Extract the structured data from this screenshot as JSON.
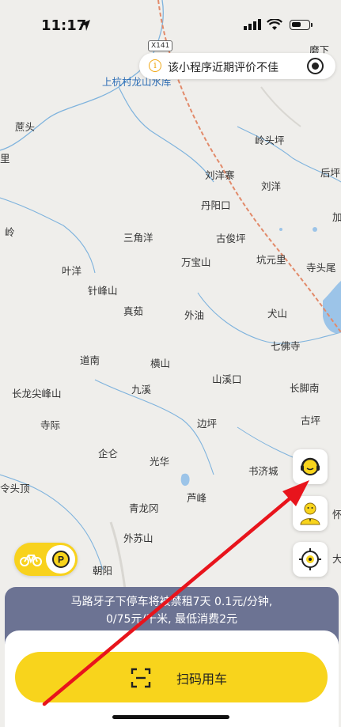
{
  "status_bar": {
    "time": "11:17"
  },
  "review_banner": {
    "text": "该小程序近期评价不佳"
  },
  "map": {
    "road_shield": "X141",
    "places": {
      "shangcun": "上杭村龙山水库",
      "moxia": "磨下",
      "zhetou": "蔗头",
      "li": "里",
      "lingtouping": "岭头坪",
      "houkeng": "后坪",
      "liuyangzhai": "刘洋寨",
      "liuyang": "刘洋",
      "danyangkou": "丹阳口",
      "jia": "加",
      "ling": "岭",
      "sanjiaoyang": "三角洋",
      "gujunping": "古俊坪",
      "wanbaoshan": "万宝山",
      "kengyuanli": "坑元里",
      "situwei": "寺头尾",
      "yeyang": "叶洋",
      "zhenfengshan": "针峰山",
      "zhengu": "真茹",
      "waiyou": "外油",
      "quanshan": "犬山",
      "qifosi": "七佛寺",
      "daonan": "道南",
      "hengshan": "横山",
      "shanxikou": "山溪口",
      "changjiaonan": "长脚南",
      "changlongjianfengshan": "长龙尖峰山",
      "jiuxi": "九溪",
      "siji": "寺际",
      "bianping": "边坪",
      "guping": "古坪",
      "qilun": "企仑",
      "guanghua": "光华",
      "shujicheng": "书济城",
      "lingshanding": "令头顶",
      "lufeng": "芦峰",
      "qinglonggang": "青龙冈",
      "huai": "怀",
      "waisushan": "外苏山",
      "chaoyang": "朝阳",
      "da": "大"
    }
  },
  "notice": {
    "line1": "马路牙子下停车将被禁租7天 0.1元/分钟,",
    "line2": "0/75元/千米, 最低消费2元"
  },
  "scan_button": {
    "label": "扫码用车"
  },
  "colors": {
    "accent": "#f8d41c",
    "notice_bg": "#6c7393",
    "arrow": "#e8141c",
    "river": "#5b9bd5"
  }
}
